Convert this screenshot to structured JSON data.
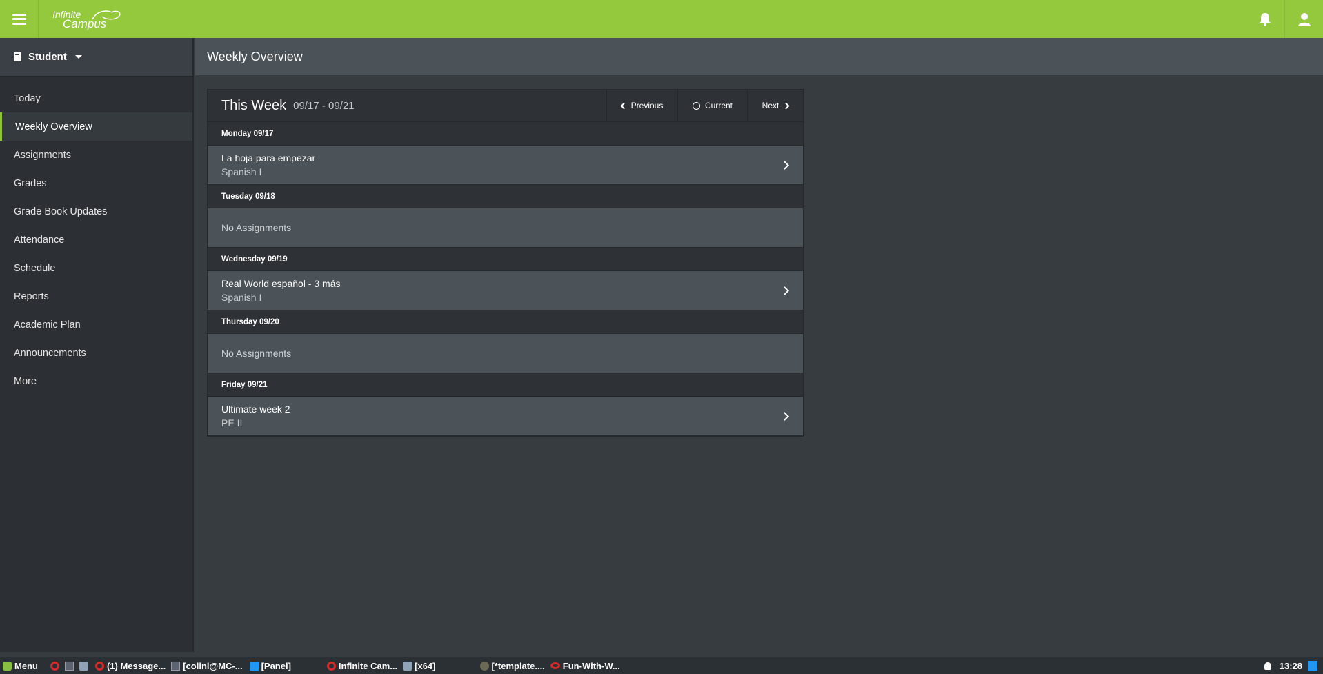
{
  "topbar": {
    "logo_line1": "Infinite",
    "logo_line2": "Campus",
    "icons": [
      "hamburger-menu-icon",
      "bell-icon",
      "user-icon"
    ],
    "brand_color": "#94c83d"
  },
  "sidebar": {
    "role": "Student",
    "items": [
      {
        "label": "Today"
      },
      {
        "label": "Weekly Overview",
        "active": true
      },
      {
        "label": "Assignments"
      },
      {
        "label": "Grades"
      },
      {
        "label": "Grade Book Updates"
      },
      {
        "label": "Attendance"
      },
      {
        "label": "Schedule"
      },
      {
        "label": "Reports"
      },
      {
        "label": "Academic Plan"
      },
      {
        "label": "Announcements"
      },
      {
        "label": "More"
      }
    ]
  },
  "page": {
    "title": "Weekly Overview"
  },
  "week": {
    "title": "This Week",
    "range": "09/17 - 09/21",
    "prev_label": "Previous",
    "current_label": "Current",
    "next_label": "Next",
    "days": [
      {
        "header": "Monday 09/17",
        "name": "La hoja para empezar",
        "course": "Spanish I"
      },
      {
        "header": "Tuesday 09/18",
        "empty": "No Assignments"
      },
      {
        "header": "Wednesday 09/19",
        "name": "Real World español - 3 más",
        "course": "Spanish I"
      },
      {
        "header": "Thursday 09/20",
        "empty": "No Assignments"
      },
      {
        "header": "Friday 09/21",
        "name": "Ultimate week 2",
        "course": "PE II"
      }
    ]
  },
  "taskbar": {
    "menu_label": "Menu",
    "items": [
      "(1) Message...",
      "[colinl@MC-...",
      "[Panel]",
      "Infinite Cam...",
      "[x64]",
      "[*template....",
      "Fun-With-W..."
    ],
    "clock": "13:28"
  }
}
